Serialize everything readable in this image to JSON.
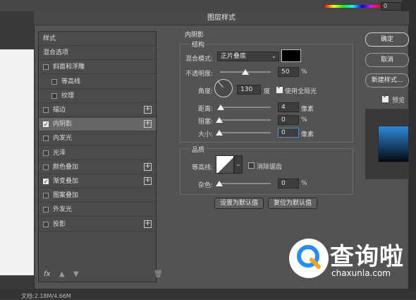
{
  "dialog": {
    "title": "图层样式"
  },
  "style_list": {
    "items": [
      {
        "label": "样式",
        "checkbox": false,
        "checked": false,
        "plus": false,
        "selected": false,
        "indent": false
      },
      {
        "label": "混合选项",
        "checkbox": false,
        "checked": false,
        "plus": false,
        "selected": false,
        "indent": false
      },
      {
        "label": "斜面和浮雕",
        "checkbox": true,
        "checked": false,
        "plus": false,
        "selected": false,
        "indent": false
      },
      {
        "label": "等高线",
        "checkbox": true,
        "checked": false,
        "plus": false,
        "selected": false,
        "indent": true
      },
      {
        "label": "纹理",
        "checkbox": true,
        "checked": false,
        "plus": false,
        "selected": false,
        "indent": true
      },
      {
        "label": "描边",
        "checkbox": true,
        "checked": false,
        "plus": true,
        "selected": false,
        "indent": false
      },
      {
        "label": "内阴影",
        "checkbox": true,
        "checked": true,
        "plus": true,
        "selected": true,
        "indent": false
      },
      {
        "label": "内发光",
        "checkbox": true,
        "checked": false,
        "plus": false,
        "selected": false,
        "indent": false
      },
      {
        "label": "光泽",
        "checkbox": true,
        "checked": false,
        "plus": false,
        "selected": false,
        "indent": false
      },
      {
        "label": "颜色叠加",
        "checkbox": true,
        "checked": false,
        "plus": true,
        "selected": false,
        "indent": false
      },
      {
        "label": "渐变叠加",
        "checkbox": true,
        "checked": true,
        "plus": true,
        "selected": false,
        "indent": false
      },
      {
        "label": "图案叠加",
        "checkbox": true,
        "checked": false,
        "plus": false,
        "selected": false,
        "indent": false
      },
      {
        "label": "外发光",
        "checkbox": true,
        "checked": false,
        "plus": false,
        "selected": false,
        "indent": false
      },
      {
        "label": "投影",
        "checkbox": true,
        "checked": false,
        "plus": true,
        "selected": false,
        "indent": false
      }
    ],
    "footer_fx": "fx"
  },
  "inner_shadow": {
    "section_title": "内阴影",
    "structure_title": "结构",
    "blend_mode_label": "混合模式:",
    "blend_mode_value": "正片叠底",
    "shadow_color": "#000000",
    "opacity_label": "不透明度:",
    "opacity_value": "50",
    "opacity_unit": "%",
    "opacity_level": 0.5,
    "angle_label": "角度:",
    "angle_value": "130",
    "angle_unit": "度",
    "global_light_label": "使用全局光",
    "global_light_checked": true,
    "distance_label": "距离:",
    "distance_value": "4",
    "distance_unit": "像素",
    "choke_label": "阻塞:",
    "choke_value": "0",
    "choke_unit": "%",
    "size_label": "大小:",
    "size_value": "0",
    "size_unit": "像素"
  },
  "quality": {
    "title": "品质",
    "contour_label": "等高线:",
    "antialias_label": "消除锯齿",
    "antialias_checked": false,
    "noise_label": "杂色:",
    "noise_value": "0",
    "noise_unit": "%"
  },
  "buttons": {
    "set_default": "设置为默认值",
    "reset_default": "复位为默认值",
    "ok": "确定",
    "cancel": "取消",
    "new_style": "新建样式...",
    "preview_label": "预览",
    "preview_checked": true
  },
  "background": {
    "status_text": "文档:2.18M/4.66M",
    "top_value": "0"
  },
  "watermark": {
    "text": "查询啦",
    "url": "chaxunla.com"
  }
}
